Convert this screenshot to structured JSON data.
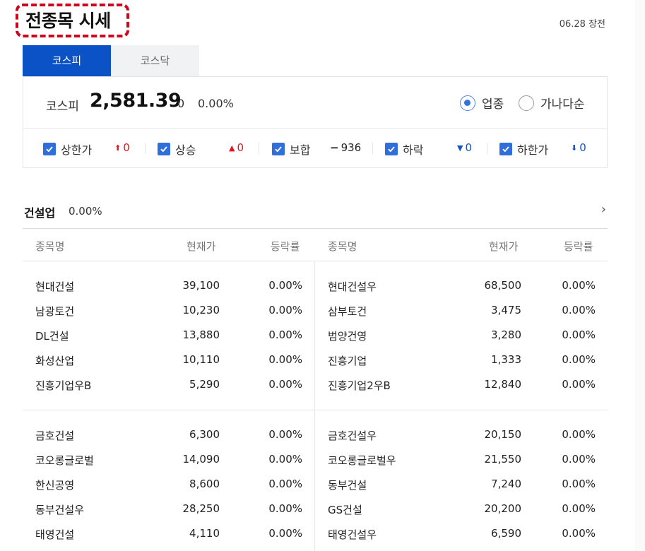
{
  "header": {
    "title": "전종목 시세",
    "status": "06.28 장전"
  },
  "tabs": [
    {
      "label": "코스피",
      "active": true
    },
    {
      "label": "코스닥",
      "active": false
    }
  ],
  "index": {
    "name": "코스피",
    "value": "2,581.39",
    "change": "0",
    "rate": "0.00%"
  },
  "sort": [
    {
      "label": "업종",
      "selected": true
    },
    {
      "label": "가나다순",
      "selected": false
    }
  ],
  "filters": [
    {
      "label": "상한가",
      "count": "0",
      "icon": "arrow-up-bold-icon",
      "color": "#e5151f"
    },
    {
      "label": "상승",
      "count": "0",
      "icon": "triangle-up-icon",
      "color": "#e5151f"
    },
    {
      "label": "보합",
      "count": "936",
      "icon": "dash-icon",
      "color": "#222222"
    },
    {
      "label": "하락",
      "count": "0",
      "icon": "triangle-down-icon",
      "color": "#1553c4"
    },
    {
      "label": "하한가",
      "count": "0",
      "icon": "arrow-down-bold-icon",
      "color": "#1553c4"
    }
  ],
  "sector": {
    "name": "건설업",
    "rate": "0.00%"
  },
  "columns": {
    "name": "종목명",
    "price": "현재가",
    "rate": "등락률"
  },
  "left_rows": [
    {
      "name": "현대건설",
      "price": "39,100",
      "rate": "0.00%"
    },
    {
      "name": "남광토건",
      "price": "10,230",
      "rate": "0.00%"
    },
    {
      "name": "DL건설",
      "price": "13,880",
      "rate": "0.00%"
    },
    {
      "name": "화성산업",
      "price": "10,110",
      "rate": "0.00%"
    },
    {
      "name": "진흥기업우B",
      "price": "5,290",
      "rate": "0.00%"
    },
    {
      "name": "금호건설",
      "price": "6,300",
      "rate": "0.00%"
    },
    {
      "name": "코오롱글로벌",
      "price": "14,090",
      "rate": "0.00%"
    },
    {
      "name": "한신공영",
      "price": "8,600",
      "rate": "0.00%"
    },
    {
      "name": "동부건설우",
      "price": "28,250",
      "rate": "0.00%"
    },
    {
      "name": "태영건설",
      "price": "4,110",
      "rate": "0.00%"
    }
  ],
  "right_rows": [
    {
      "name": "현대건설우",
      "price": "68,500",
      "rate": "0.00%"
    },
    {
      "name": "삼부토건",
      "price": "3,475",
      "rate": "0.00%"
    },
    {
      "name": "범양건영",
      "price": "3,280",
      "rate": "0.00%"
    },
    {
      "name": "진흥기업",
      "price": "1,333",
      "rate": "0.00%"
    },
    {
      "name": "진흥기업2우B",
      "price": "12,840",
      "rate": "0.00%"
    },
    {
      "name": "금호건설우",
      "price": "20,150",
      "rate": "0.00%"
    },
    {
      "name": "코오롱글로벌우",
      "price": "21,550",
      "rate": "0.00%"
    },
    {
      "name": "동부건설",
      "price": "7,240",
      "rate": "0.00%"
    },
    {
      "name": "GS건설",
      "price": "20,200",
      "rate": "0.00%"
    },
    {
      "name": "태영건설우",
      "price": "6,590",
      "rate": "0.00%"
    }
  ]
}
